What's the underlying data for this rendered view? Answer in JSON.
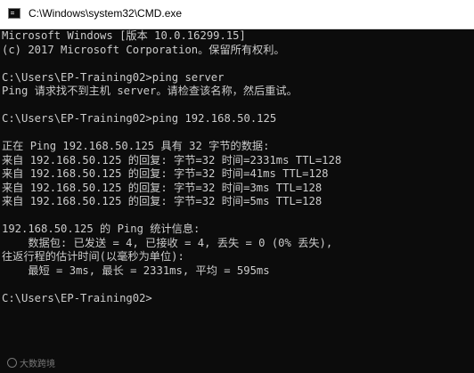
{
  "window": {
    "title": "C:\\Windows\\system32\\CMD.exe",
    "icon": "cmd-icon",
    "background": "#0c0c0c",
    "text_color": "#cccccc"
  },
  "console": {
    "lines": [
      "Microsoft Windows [版本 10.0.16299.15]",
      "(c) 2017 Microsoft Corporation。保留所有权利。",
      "",
      "C:\\Users\\EP-Training02>ping server",
      "Ping 请求找不到主机 server。请检查该名称，然后重试。",
      "",
      "C:\\Users\\EP-Training02>ping 192.168.50.125",
      "",
      "正在 Ping 192.168.50.125 具有 32 字节的数据:",
      "来自 192.168.50.125 的回复: 字节=32 时间=2331ms TTL=128",
      "来自 192.168.50.125 的回复: 字节=32 时间=41ms TTL=128",
      "来自 192.168.50.125 的回复: 字节=32 时间=3ms TTL=128",
      "来自 192.168.50.125 的回复: 字节=32 时间=5ms TTL=128",
      "",
      "192.168.50.125 的 Ping 统计信息:",
      "    数据包: 已发送 = 4, 已接收 = 4, 丢失 = 0 (0% 丢失),",
      "往返行程的估计时间(以毫秒为单位):",
      "    最短 = 3ms, 最长 = 2331ms, 平均 = 595ms",
      "",
      "C:\\Users\\EP-Training02>"
    ]
  },
  "watermark": {
    "text": "大数跨境"
  }
}
